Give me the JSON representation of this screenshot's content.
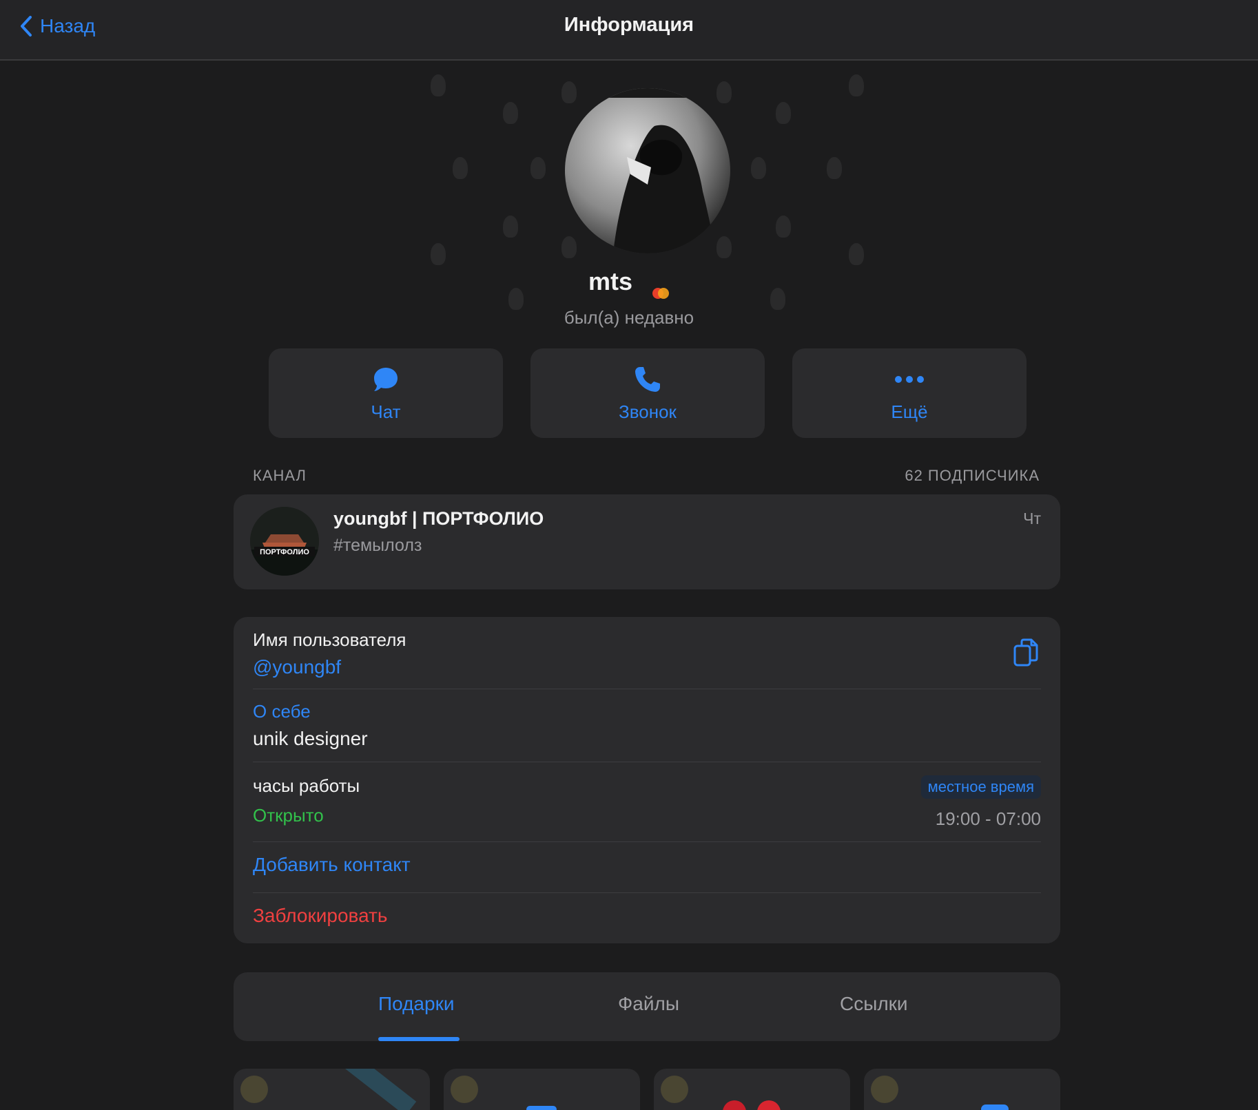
{
  "header": {
    "back_label": "Назад",
    "title": "Информация"
  },
  "profile": {
    "name": "mts",
    "status": "был(а) недавно"
  },
  "actions": [
    {
      "label": "Чат",
      "icon": "chat-bubble-icon"
    },
    {
      "label": "Звонок",
      "icon": "phone-icon"
    },
    {
      "label": "Ещё",
      "icon": "more-dots-icon"
    }
  ],
  "channel_section": {
    "label": "КАНАЛ",
    "subscribers": "62 ПОДПИСЧИКА"
  },
  "channel": {
    "title": "youngbf | ПОРТФОЛИО",
    "subtitle": "#темылолз",
    "day": "Чт",
    "avatar_text": "ПОРТФОЛИО"
  },
  "info": {
    "username_label": "Имя пользователя",
    "username": "@youngbf",
    "about_label": "О себе",
    "about": "unik designer",
    "hours_label": "часы работы",
    "hours_badge": "местное время",
    "hours_status": "Открыто",
    "hours_range": "19:00 - 07:00",
    "add_contact": "Добавить контакт",
    "block": "Заблокировать"
  },
  "tabs": [
    {
      "label": "Подарки",
      "active": true
    },
    {
      "label": "Файлы",
      "active": false
    },
    {
      "label": "Ссылки",
      "active": false
    }
  ],
  "colors": {
    "accent": "#2f86f6",
    "open_green": "#32c14b",
    "danger": "#f04040",
    "background": "#1c1c1d",
    "card": "#2b2b2d"
  }
}
